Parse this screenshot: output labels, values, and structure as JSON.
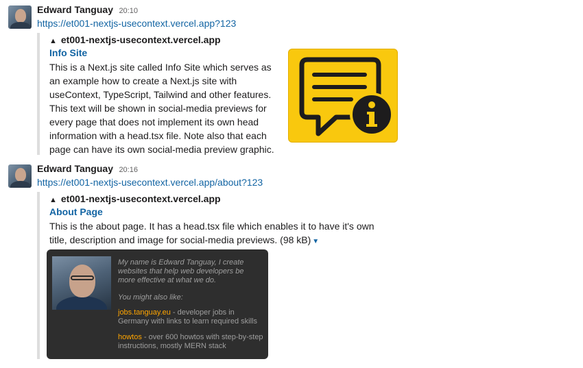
{
  "messages": [
    {
      "author": "Edward Tanguay",
      "time": "20:10",
      "link": "https://et001-nextjs-usecontext.vercel.app?123",
      "unfurl": {
        "site": "et001-nextjs-usecontext.vercel.app",
        "site_icon": "triangle-logo-icon",
        "title": "Info Site",
        "description": "This is a Next.js site called Info Site which serves as an example how to create a Next.js site with useContext, TypeScript, Tailwind and other features. This text will be shown in social-media previews for every page that does not implement its own head information with a head.tsx file. Note also that each page can have its own social-media preview graphic.",
        "image_icon": "chat-info-icon"
      }
    },
    {
      "author": "Edward Tanguay",
      "time": "20:16",
      "link": "https://et001-nextjs-usecontext.vercel.app/about?123",
      "unfurl": {
        "site": "et001-nextjs-usecontext.vercel.app",
        "site_icon": "triangle-logo-icon",
        "title": "About Page",
        "description": "This is the about page. It has a head.tsx file which enables it to have it's own title, description and image for social-media previews.",
        "size": "(98 kB)",
        "card": {
          "intro": "My name is Edward Tanguay, I create websites that help web developers be more effective at what we do.",
          "also_like": "You might also like:",
          "links": [
            {
              "name": "jobs.tanguay.eu",
              "text": " - developer jobs in Germany with links to learn required skills"
            },
            {
              "name": "howtos",
              "text": " - over 600 howtos with step-by-step instructions, mostly MERN stack"
            }
          ]
        }
      }
    }
  ],
  "colors": {
    "link": "#1264a3",
    "accent_yellow": "#f9c80e",
    "card_bg": "#2e2e2e",
    "card_link": "#ffa500"
  }
}
